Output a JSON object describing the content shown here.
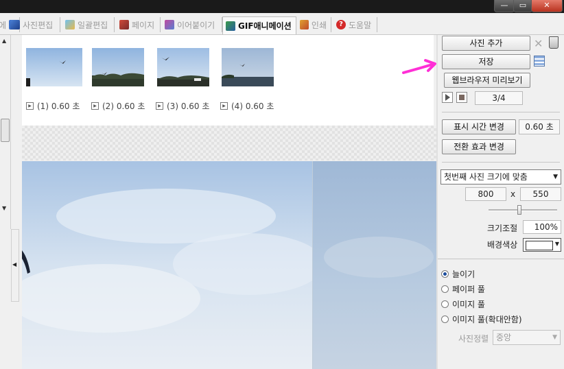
{
  "window": {
    "minimize": "—",
    "maximize": "▭",
    "close": "✕"
  },
  "tabs": [
    {
      "label": "에",
      "icon": "blue"
    },
    {
      "label": "사진편집",
      "icon": "photo"
    },
    {
      "label": "일괄편집",
      "icon": "batch"
    },
    {
      "label": "페이지",
      "icon": "page"
    },
    {
      "label": "이어붙이기",
      "icon": "join"
    },
    {
      "label": "GIF애니메이션",
      "icon": "gif"
    },
    {
      "label": "인쇄",
      "icon": "print"
    },
    {
      "label": "도움말",
      "icon": "help"
    }
  ],
  "thumbnails": [
    {
      "label": "(1) 0.60 초"
    },
    {
      "label": "(2) 0.60 초"
    },
    {
      "label": "(3) 0.60 초"
    },
    {
      "label": "(4) 0.60 초"
    }
  ],
  "panel": {
    "add_photo": "사진 추가",
    "save": "저장",
    "preview_browser": "웹브라우저 미리보기",
    "frame_counter": "3/4",
    "display_time_button": "표시 시간 변경",
    "display_time_value": "0.60 초",
    "transition_button": "전환 효과 변경",
    "size_mode": "첫번째 사진 크기에 맞춤",
    "width": "800",
    "x_label": "x",
    "height": "550",
    "scale_label": "크기조절",
    "scale_value": "100%",
    "bg_label": "배경색상",
    "bg_color": "#ffffff",
    "slider_value_fraction": 0.45,
    "fit_options": [
      {
        "label": "늘이기",
        "checked": true
      },
      {
        "label": "페이퍼 풀",
        "checked": false
      },
      {
        "label": "이미지 풀",
        "checked": false
      },
      {
        "label": "이미지 풀(확대안함)",
        "checked": false
      }
    ],
    "align_label": "사진정렬",
    "align_value": "중앙"
  },
  "colors": {
    "accent_arrow": "#ff2fd6",
    "radio_dot": "#1c4d9c"
  }
}
